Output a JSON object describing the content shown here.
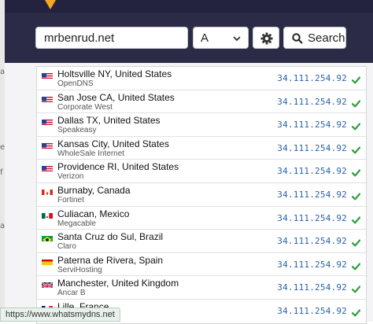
{
  "search": {
    "value": "mrbenrud.net",
    "record_type": "A",
    "button_label": "Search"
  },
  "results": [
    {
      "location": "Holtsville NY, United States",
      "provider": "OpenDNS",
      "ip": "34.111.254.92",
      "flag": "us-flag"
    },
    {
      "location": "San Jose CA, United States",
      "provider": "Corporate West",
      "ip": "34.111.254.92",
      "flag": "us-flag"
    },
    {
      "location": "Dallas TX, United States",
      "provider": "Speakeasy",
      "ip": "34.111.254.92",
      "flag": "us-flag"
    },
    {
      "location": "Kansas City, United States",
      "provider": "WholeSale Internet",
      "ip": "34.111.254.92",
      "flag": "us-flag"
    },
    {
      "location": "Providence RI, United States",
      "provider": "Verizon",
      "ip": "34.111.254.92",
      "flag": "us-flag"
    },
    {
      "location": "Burnaby, Canada",
      "provider": "Fortinet",
      "ip": "34.111.254.92",
      "flag": "ca-flag"
    },
    {
      "location": "Culiacan, Mexico",
      "provider": "Megacable",
      "ip": "34.111.254.92",
      "flag": "mx-flag"
    },
    {
      "location": "Santa Cruz do Sul, Brazil",
      "provider": "Claro",
      "ip": "34.111.254.92",
      "flag": "br-flag"
    },
    {
      "location": "Paterna de Rivera, Spain",
      "provider": "ServiHosting",
      "ip": "34.111.254.92",
      "flag": "es-flag"
    },
    {
      "location": "Manchester, United Kingdom",
      "provider": "Ancar B",
      "ip": "34.111.254.92",
      "flag": "gb-flag"
    },
    {
      "location": "Lille, France",
      "provider": "",
      "ip": "34.111.254.92",
      "flag": "fr-flag"
    }
  ],
  "status_bar": {
    "url": "https://www.whatsmydns.net"
  },
  "colors": {
    "header": "#2b2b48",
    "accent": "#f5a623",
    "ip": "#2a62a8",
    "ok": "#2e9e3f"
  }
}
